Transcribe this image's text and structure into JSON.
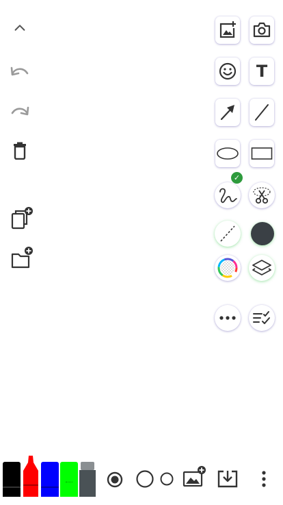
{
  "left_toolbar": {
    "collapse_icon": "chevron-up-icon",
    "undo_icon": "undo-icon",
    "redo_icon": "redo-icon",
    "delete_icon": "trash-icon",
    "add_page_icon": "add-page-icon",
    "add_folder_icon": "add-folder-icon"
  },
  "tool_panel": {
    "selected_tool": "freehand-lasso",
    "selected_badge": "✓",
    "text_tool_glyph": "T",
    "fill_color": "#3a4045"
  },
  "pens": [
    {
      "name": "black-marker",
      "color": "#000000"
    },
    {
      "name": "red-marker",
      "color": "#ff0000"
    },
    {
      "name": "blue-marker",
      "color": "#0000ff"
    },
    {
      "name": "green-marker",
      "color": "#00ff00"
    },
    {
      "name": "gray-eraser",
      "color": "#4a5256"
    }
  ],
  "brush_sizes": [
    "large",
    "medium",
    "small"
  ],
  "selected_brush_size": "large"
}
